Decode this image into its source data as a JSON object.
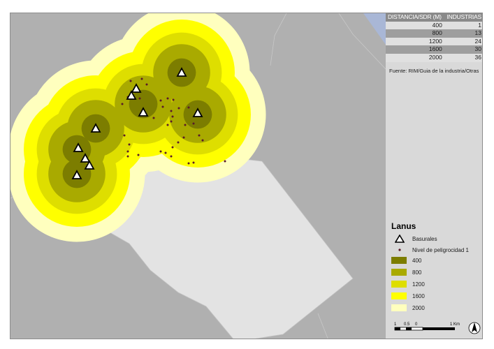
{
  "map": {
    "colors": {
      "background": "#b0b0b0",
      "district": "#e3e3e3",
      "water": "#a9b7d6",
      "ring_400": "#7c7d00",
      "ring_800": "#a9aa00",
      "ring_1200": "#dede00",
      "ring_1600": "#ffff00",
      "ring_2000": "#ffffbe",
      "industry_dot": "#5a1a2a"
    }
  },
  "table": {
    "header_distance": "DISTANCIA/SDR (M)",
    "header_industries": "INDUSTRIAS",
    "rows": [
      {
        "distance": "400",
        "industries": "1"
      },
      {
        "distance": "800",
        "industries": "13"
      },
      {
        "distance": "1200",
        "industries": "24"
      },
      {
        "distance": "1600",
        "industries": "30"
      },
      {
        "distance": "2000",
        "industries": "36"
      }
    ]
  },
  "source": "Fuente: RIM/Guia de la industria/Otras",
  "legend": {
    "title": "Lanus",
    "basurales_label": "Basurales",
    "nivel_label": "Nivel de peligrocidad 1",
    "rings": [
      {
        "label": "400",
        "color": "#7c7d00"
      },
      {
        "label": "800",
        "color": "#a9aa00"
      },
      {
        "label": "1200",
        "color": "#dede00"
      },
      {
        "label": "1600",
        "color": "#ffff00"
      },
      {
        "label": "2000",
        "color": "#ffffbe"
      }
    ]
  },
  "scale": {
    "labels": [
      "1",
      "0.5",
      "0",
      "1 Km"
    ]
  },
  "north_icon": "north-arrow-icon"
}
